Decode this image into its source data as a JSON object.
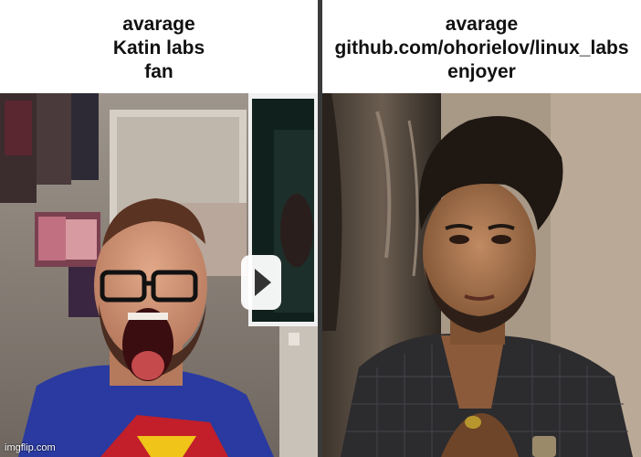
{
  "left_caption": {
    "line1": "avarage",
    "line2": "Katin labs",
    "line3": "fan"
  },
  "right_caption": {
    "line1": "avarage",
    "line2": "github.com/ohorielov/linux_labs",
    "line3": "enjoyer"
  },
  "left_image": {
    "description_icon": "play-icon"
  },
  "watermark": "imgflip.com",
  "colors": {
    "divider": "#3a3a3a",
    "caption": "#111111",
    "background": "#ffffff"
  }
}
